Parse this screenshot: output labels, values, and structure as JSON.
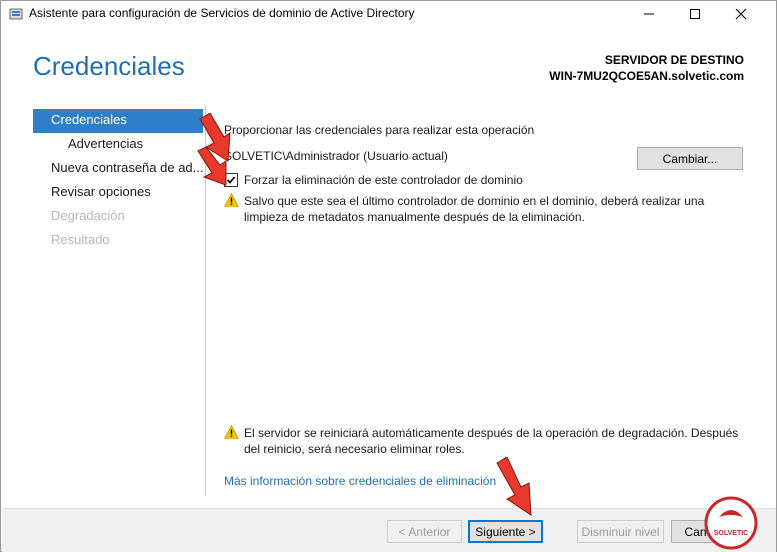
{
  "window": {
    "title": "Asistente para configuración de Servicios de dominio de Active Directory"
  },
  "header": {
    "page_title": "Credenciales",
    "destination_label": "SERVIDOR DE DESTINO",
    "destination_server": "WIN-7MU2QCOE5AN.solvetic.com"
  },
  "nav": {
    "items": [
      {
        "label": "Credenciales",
        "state": "active"
      },
      {
        "label": "Advertencias",
        "state": "normal"
      },
      {
        "label": "Nueva contraseña de ad...",
        "state": "normal"
      },
      {
        "label": "Revisar opciones",
        "state": "normal"
      },
      {
        "label": "Degradación",
        "state": "disabled"
      },
      {
        "label": "Resultado",
        "state": "disabled"
      }
    ]
  },
  "content": {
    "intro": "Proporcionar las credenciales para realizar esta operación",
    "current_user": "SOLVETIC\\Administrador (Usuario actual)",
    "change_button": "Cambiar...",
    "force_checkbox_label": "Forzar la eliminación de este controlador de dominio",
    "force_checkbox_checked": true,
    "warning_metadata": "Salvo que este sea el último controlador de dominio en el dominio, deberá realizar una limpieza de metadatos manualmente después de la eliminación.",
    "warning_restart": "El servidor se reiniciará automáticamente después de la operación de degradación. Después del reinicio, será necesario eliminar roles.",
    "more_info_link": "Más información sobre credenciales de eliminación"
  },
  "footer": {
    "back_button": "< Anterior",
    "next_button": "Siguiente >",
    "demote_button": "Disminuir nivel",
    "cancel_button": "Cancelar"
  },
  "colors": {
    "accent": "#1f6fb5",
    "nav_active": "#2f7fc8",
    "arrow": "#e8392c",
    "warning": "#f5c400"
  },
  "watermark": {
    "text": "SOLVETIC"
  }
}
